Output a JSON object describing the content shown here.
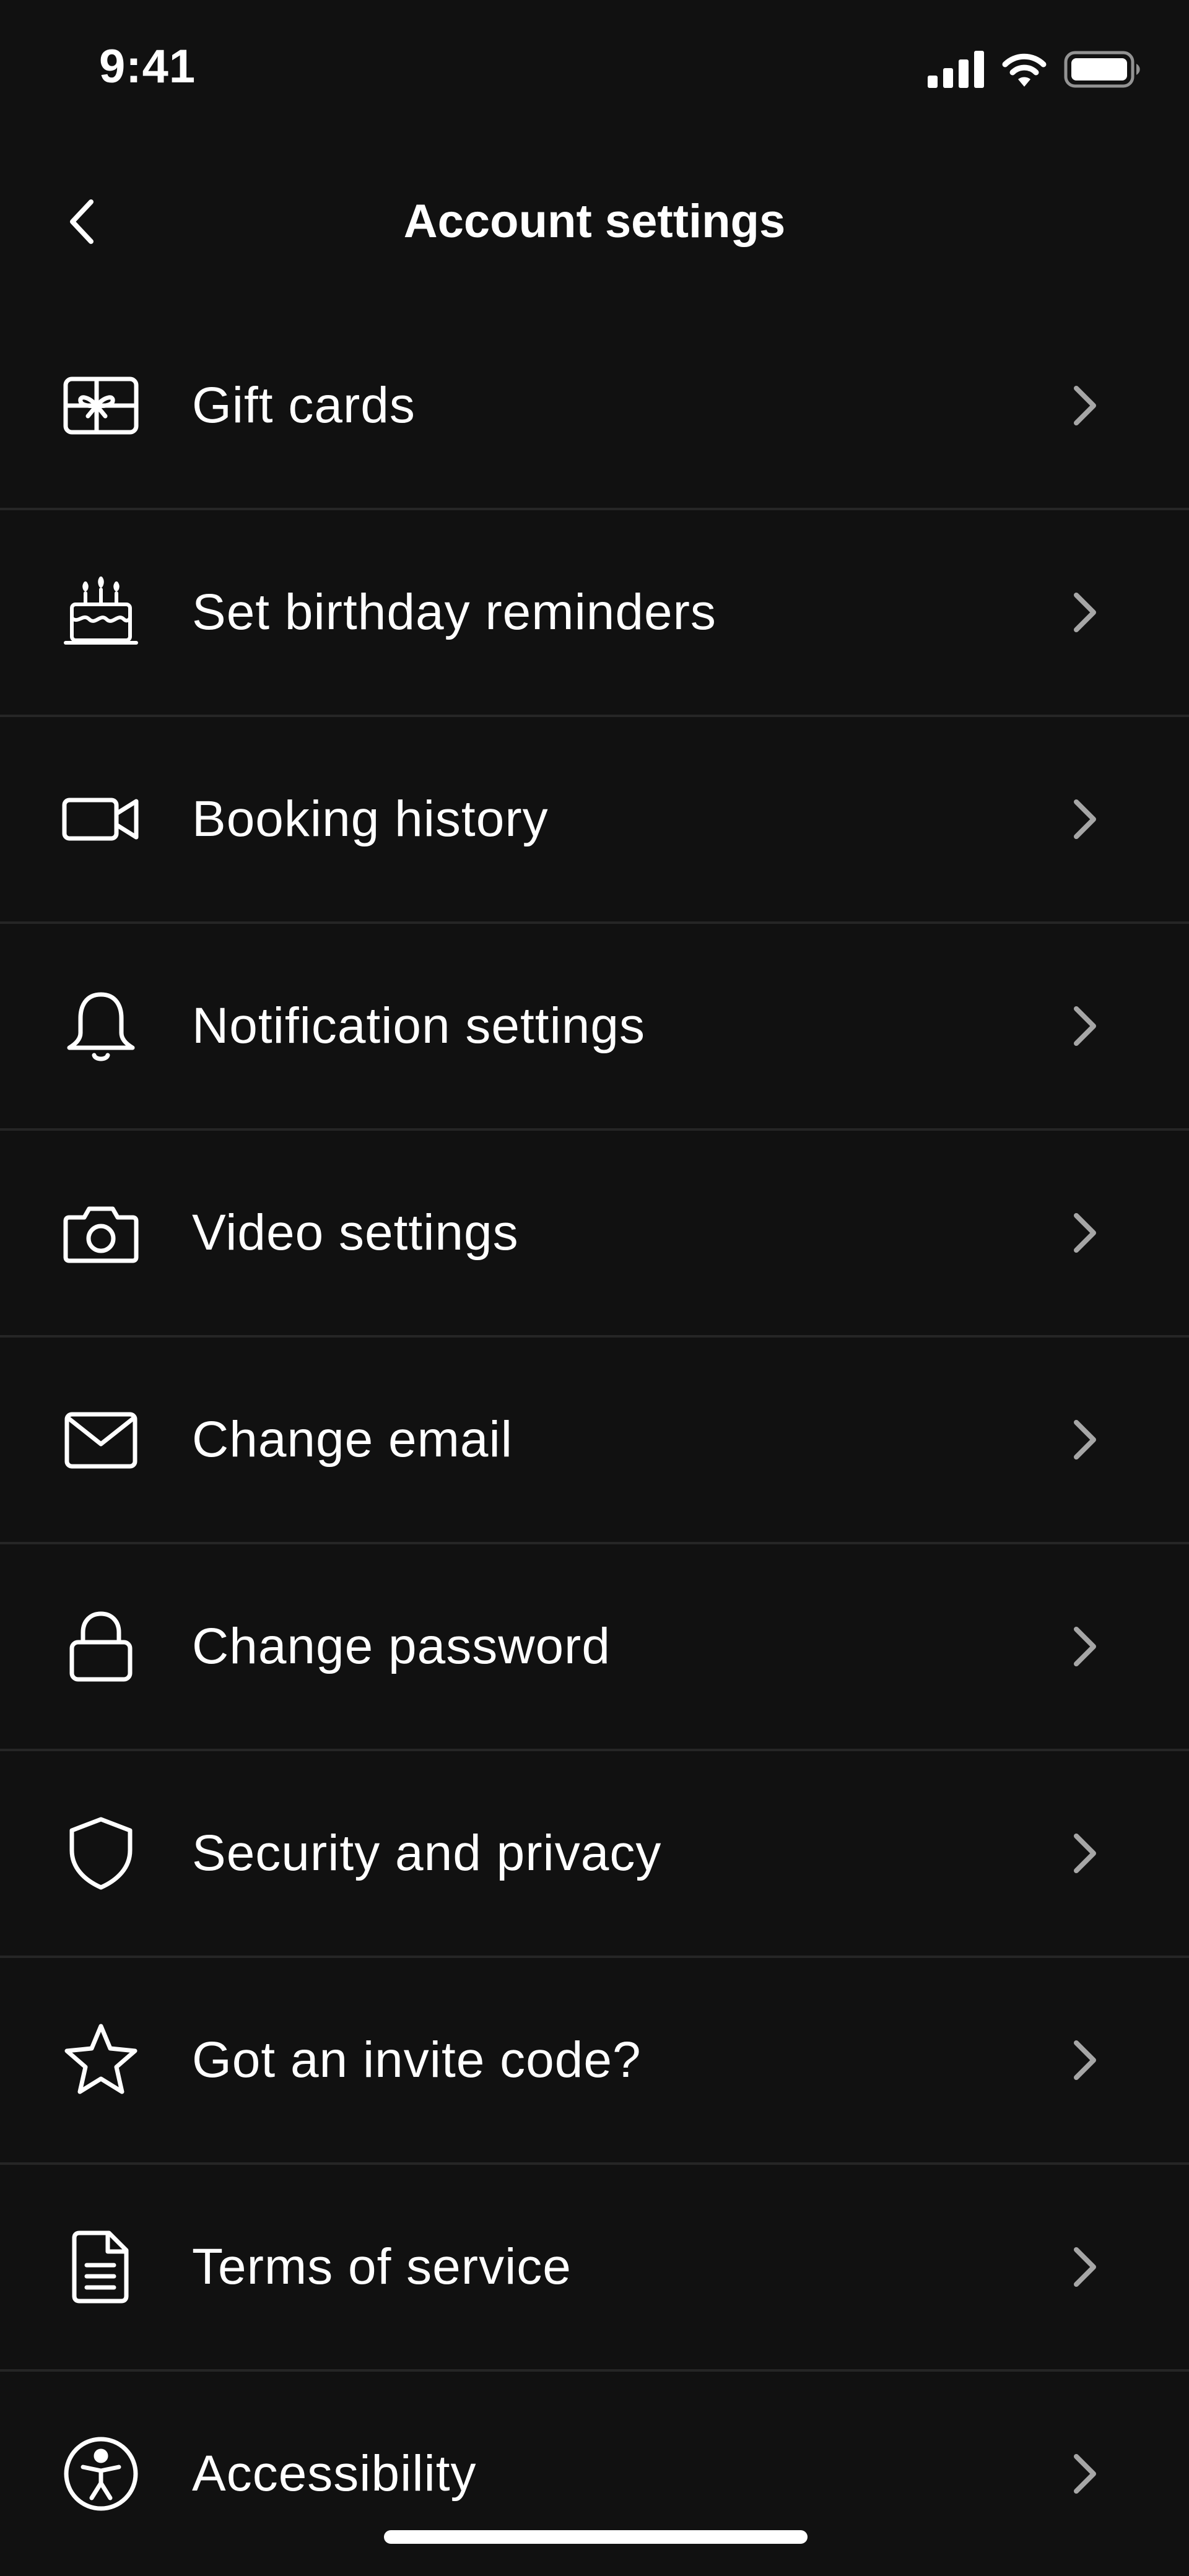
{
  "status_bar": {
    "time": "9:41",
    "icons": [
      "cellular-signal-icon",
      "wifi-icon",
      "battery-icon"
    ]
  },
  "header": {
    "title": "Account settings",
    "back_icon": "chevron-left-icon"
  },
  "settings": [
    {
      "id": "gift-cards",
      "label": "Gift cards",
      "icon": "gift-card-icon"
    },
    {
      "id": "birthday-reminders",
      "label": "Set birthday reminders",
      "icon": "birthday-cake-icon"
    },
    {
      "id": "booking-history",
      "label": "Booking history",
      "icon": "video-camera-icon"
    },
    {
      "id": "notification-settings",
      "label": "Notification settings",
      "icon": "bell-icon"
    },
    {
      "id": "video-settings",
      "label": "Video settings",
      "icon": "camera-icon"
    },
    {
      "id": "change-email",
      "label": "Change email",
      "icon": "envelope-icon"
    },
    {
      "id": "change-password",
      "label": "Change password",
      "icon": "lock-icon"
    },
    {
      "id": "security-privacy",
      "label": "Security and privacy",
      "icon": "shield-icon"
    },
    {
      "id": "invite-code",
      "label": "Got an invite code?",
      "icon": "star-icon"
    },
    {
      "id": "terms-of-service",
      "label": "Terms of service",
      "icon": "document-icon"
    },
    {
      "id": "accessibility",
      "label": "Accessibility",
      "icon": "accessibility-icon"
    }
  ],
  "colors": {
    "background": "#111111",
    "text": "#ffffff",
    "divider": "#262626",
    "chevron": "#a6a6a6"
  }
}
